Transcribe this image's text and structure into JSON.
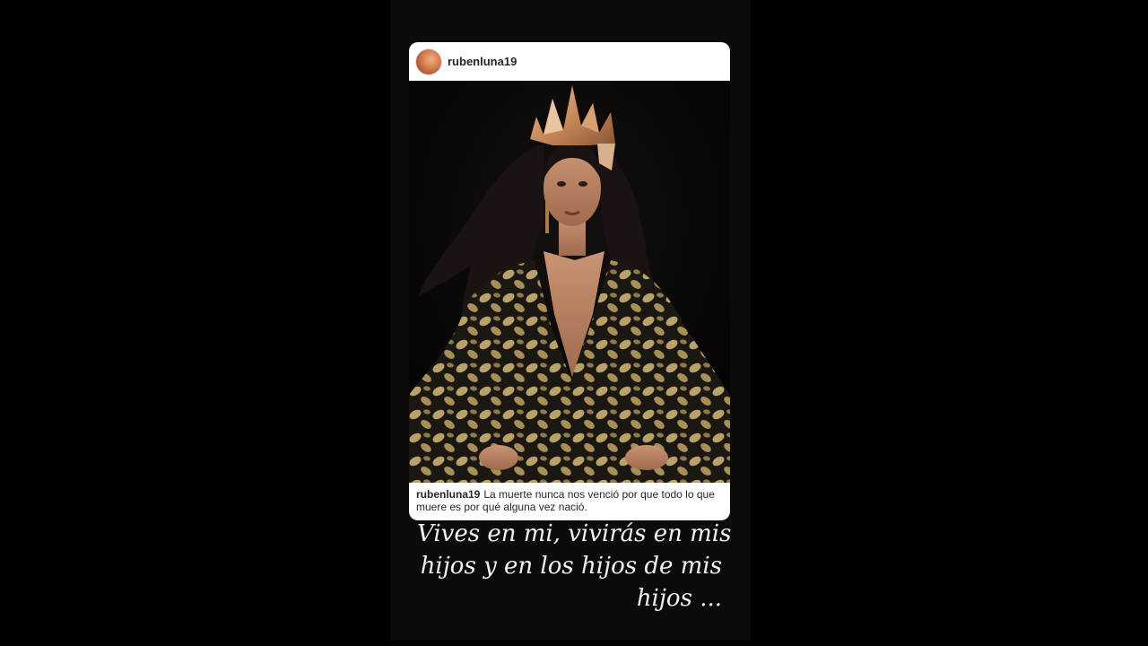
{
  "post": {
    "username": "rubenluna19",
    "caption_user": "rubenluna19",
    "caption_text": "La muerte nunca nos venció por que todo lo que muere es por qué alguna vez nació."
  },
  "overlay_text": {
    "line1": "Vives en mi, vivirás  en mis",
    "line2": "hijos y en los hijos de mis",
    "line3": "hijos ..."
  },
  "colors": {
    "background": "#000000",
    "story_background": "#0d0b0a",
    "card_white": "#ffffff",
    "text_dark": "#262626",
    "overlay_text": "#f2f2f2",
    "crown_gold": "#c98a5a",
    "dress_pattern": "#b9a26a"
  },
  "icons": {
    "avatar": "profile-photo"
  }
}
